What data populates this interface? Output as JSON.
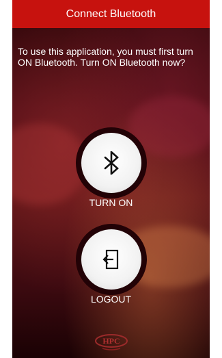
{
  "header": {
    "title": "Connect Bluetooth"
  },
  "message": {
    "text": "To use this application, you must first turn ON Bluetooth. Turn ON Bluetooth now?"
  },
  "actions": {
    "turn_on": {
      "label": "TURN ON",
      "icon": "bluetooth-icon"
    },
    "logout": {
      "label": "LOGOUT",
      "icon": "exit-icon"
    }
  },
  "logo": {
    "text": "HPC"
  },
  "colors": {
    "header_bg": "#c7120e",
    "background_dark": "#3c0a10",
    "button_face": "#f2f2f2"
  }
}
